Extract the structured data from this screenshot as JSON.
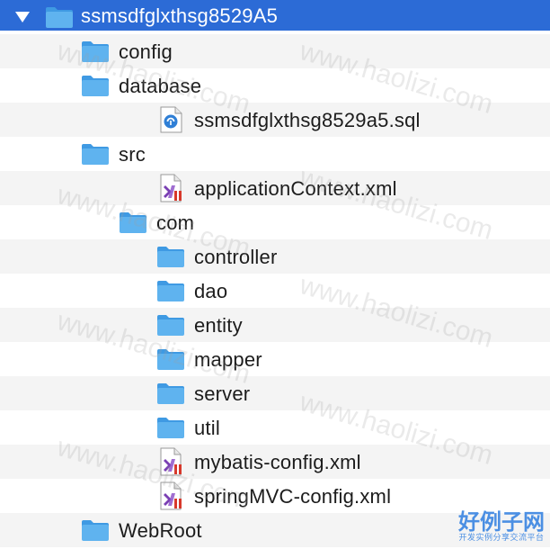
{
  "tree": {
    "rows": [
      {
        "label": "ssmsdfglxthsg8529A5",
        "icon": "folder-icon",
        "state": "expanded",
        "depth": 0,
        "selected": true
      },
      {
        "label": "config",
        "icon": "folder-icon",
        "state": "collapsed",
        "depth": 1
      },
      {
        "label": "database",
        "icon": "folder-icon",
        "state": "expanded",
        "depth": 1
      },
      {
        "label": "ssmsdfglxthsg8529a5.sql",
        "icon": "sql-file-icon",
        "state": "none",
        "depth": 2
      },
      {
        "label": "src",
        "icon": "folder-icon",
        "state": "expanded",
        "depth": 1
      },
      {
        "label": "applicationContext.xml",
        "icon": "xml-file-icon",
        "state": "none",
        "depth": 2
      },
      {
        "label": "com",
        "icon": "folder-icon",
        "state": "expanded",
        "depth": 2
      },
      {
        "label": "controller",
        "icon": "folder-icon",
        "state": "collapsed",
        "depth": 3
      },
      {
        "label": "dao",
        "icon": "folder-icon",
        "state": "collapsed",
        "depth": 3
      },
      {
        "label": "entity",
        "icon": "folder-icon",
        "state": "collapsed",
        "depth": 3
      },
      {
        "label": "mapper",
        "icon": "folder-icon",
        "state": "collapsed",
        "depth": 3
      },
      {
        "label": "server",
        "icon": "folder-icon",
        "state": "collapsed",
        "depth": 3
      },
      {
        "label": "util",
        "icon": "folder-icon",
        "state": "collapsed",
        "depth": 3
      },
      {
        "label": "mybatis-config.xml",
        "icon": "xml-file-icon",
        "state": "none",
        "depth": 2
      },
      {
        "label": "springMVC-config.xml",
        "icon": "xml-file-icon",
        "state": "none",
        "depth": 2
      },
      {
        "label": "WebRoot",
        "icon": "folder-icon",
        "state": "collapsed",
        "depth": 1
      }
    ]
  },
  "watermark": {
    "text": "www.haolizi.com"
  },
  "brand": {
    "main": "好例子网",
    "sub": "开发实例分享交流平台"
  },
  "colors": {
    "selection": "#2c6bd6",
    "folder": "#5fb3ef",
    "folder_dark": "#3f9ae3",
    "stripe": "#f4f4f4"
  }
}
